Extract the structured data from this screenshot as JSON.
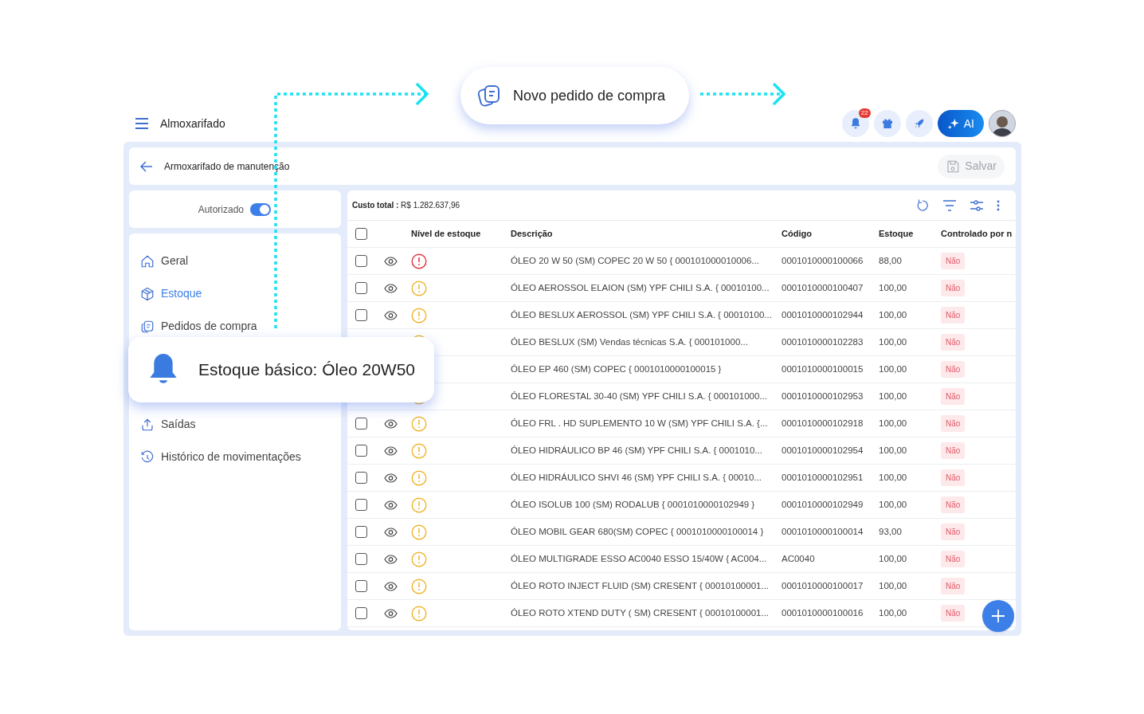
{
  "callout": {
    "label": "Novo pedido de compra"
  },
  "app_bar": {
    "title": "Almoxarifado",
    "notifications_badge": "22",
    "ai_button": "AI"
  },
  "header": {
    "title": "Armoxarifado de manutenção",
    "save_button": "Salvar"
  },
  "authorized": {
    "label": "Autorizado",
    "on": true
  },
  "sidebar": {
    "items": [
      {
        "label": "Geral",
        "kind": "home",
        "selected": false
      },
      {
        "label": "Estoque",
        "kind": "box",
        "selected": true
      },
      {
        "label": "Pedidos de compra",
        "kind": "orders",
        "selected": false
      },
      {
        "label": "Saídas",
        "kind": "exit",
        "selected": false
      },
      {
        "label": "Histórico de movimentações",
        "kind": "history",
        "selected": false
      }
    ]
  },
  "notification": {
    "text": "Estoque básico: Óleo 20W50"
  },
  "table": {
    "total_label": "Custo total :",
    "total_value": "R$ 1.282.637,96",
    "select_all_checked": false,
    "columns": [
      "Nível de estoque",
      "Descrição",
      "Código",
      "Estoque",
      "Controlado por n"
    ],
    "rows": [
      {
        "checked": false,
        "kind": "critical",
        "description": "ÓLEO 20 W 50 (SM) COPEC 20 W 50 { 000101000010006...",
        "code": "0001010000100066",
        "stock": "88,00",
        "controlled": "Não"
      },
      {
        "checked": false,
        "kind": "warning",
        "description": "ÓLEO AEROSSOL ELAION (SM) YPF CHILI S.A. { 00010100...",
        "code": "0001010000100407",
        "stock": "100,00",
        "controlled": "Não"
      },
      {
        "checked": false,
        "kind": "warning",
        "description": "ÓLEO BESLUX AEROSSOL (SM) YPF CHILI S.A. { 00010100...",
        "code": "0001010000102944",
        "stock": "100,00",
        "controlled": "Não"
      },
      {
        "kind": "warning",
        "description": "ÓLEO BESLUX (SM) Vendas técnicas S.A. { 000101000...",
        "code": "0001010000102283",
        "stock": "100,00",
        "controlled": "Não"
      },
      {
        "description": "ÓLEO EP 460 (SM) COPEC { 0001010000100015 }",
        "code": "0001010000100015",
        "stock": "100,00",
        "controlled": "Não"
      },
      {
        "kind": "warning",
        "description": "ÓLEO FLORESTAL 30-40 (SM) YPF CHILI S.A. { 000101000...",
        "code": "0001010000102953",
        "stock": "100,00",
        "controlled": "Não"
      },
      {
        "checked": false,
        "kind": "warning",
        "description": "ÓLEO FRL . HD SUPLEMENTO 10 W (SM) YPF CHILI S.A. {...",
        "code": "0001010000102918",
        "stock": "100,00",
        "controlled": "Não"
      },
      {
        "checked": false,
        "kind": "warning",
        "description": "ÓLEO HIDRÁULICO BP 46 (SM) YPF CHILI S.A. { 0001010...",
        "code": "0001010000102954",
        "stock": "100,00",
        "controlled": "Não"
      },
      {
        "checked": false,
        "kind": "warning",
        "description": "ÓLEO HIDRÁULICO SHVI 46 (SM) YPF CHILI S.A. { 00010...",
        "code": "0001010000102951",
        "stock": "100,00",
        "controlled": "Não"
      },
      {
        "checked": false,
        "kind": "warning",
        "description": "ÓLEO ISOLUB 100 (SM) RODALUB { 0001010000102949 }",
        "code": "0001010000102949",
        "stock": "100,00",
        "controlled": "Não"
      },
      {
        "checked": false,
        "kind": "warning",
        "description": "ÓLEO MOBIL GEAR 680(SM) COPEC { 0001010000100014 }",
        "code": "0001010000100014",
        "stock": "93,00",
        "controlled": "Não"
      },
      {
        "checked": false,
        "kind": "warning",
        "description": "ÓLEO MULTIGRADE ESSO AC0040 ESSO 15/40W { AC004...",
        "code": "AC0040",
        "stock": "100,00",
        "controlled": "Não"
      },
      {
        "checked": false,
        "kind": "warning",
        "description": "ÓLEO ROTO INJECT FLUID (SM) CRESENT { 00010100001...",
        "code": "0001010000100017",
        "stock": "100,00",
        "controlled": "Não"
      },
      {
        "checked": false,
        "kind": "warning",
        "description": "ÓLEO ROTO XTEND DUTY ( SM) CRESENT { 00010100001...",
        "code": "0001010000100016",
        "stock": "100,00",
        "controlled": "Não"
      }
    ]
  }
}
